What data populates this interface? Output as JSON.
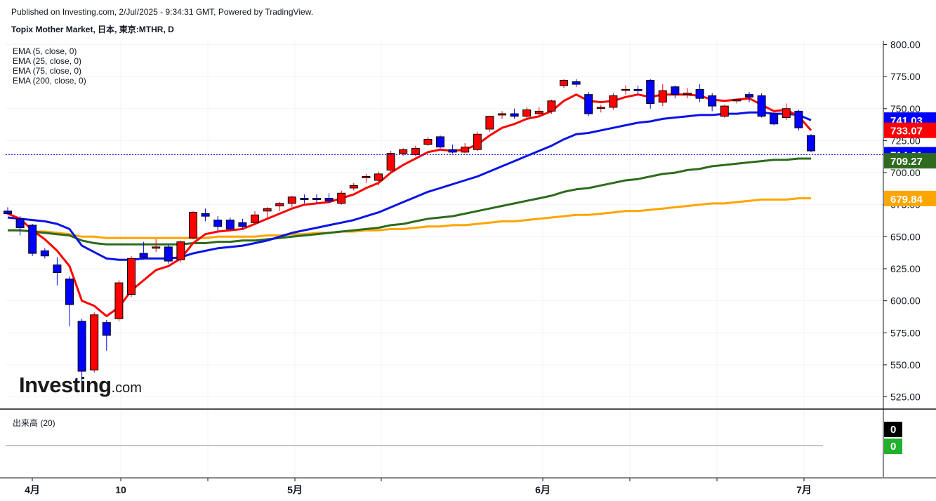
{
  "header": {
    "published": "Published on Investing.com, 2/Jul/2025 - 9:34:31 GMT, Powered by TradingView.",
    "title": "Topix Mother Market, 日本, 東京:MTHR, D"
  },
  "legend": [
    "EMA (5, close, 0)",
    "EMA (25, close, 0)",
    "EMA (75, close, 0)",
    "EMA (200, close, 0)"
  ],
  "volume_legend": "出来高 (20)",
  "logo": {
    "main": "Investing",
    "suffix": ".com"
  },
  "colors": {
    "up": "#ff0000",
    "down": "#0000ff",
    "ema5": "#ff0000",
    "ema25": "#0a14e6",
    "ema75": "#2e6b1f",
    "ema200": "#ffa500",
    "last_price_line": "#0000ff"
  },
  "chart_data": {
    "type": "candlestick",
    "x_labels": [
      "4月",
      "10",
      "5月",
      "6月",
      "7月"
    ],
    "y_ticks": [
      525,
      550,
      575,
      600,
      625,
      650,
      675,
      700,
      725,
      750,
      775,
      800
    ],
    "y_tick_labels": [
      "525.00",
      "550.00",
      "575.00",
      "600.00",
      "625.00",
      "650.00",
      "675.00",
      "700.00",
      "725.00",
      "750.00",
      "775.00",
      "800.00"
    ],
    "ylim": [
      516,
      803
    ],
    "grid": true,
    "last_price": 714.01,
    "price_labels": [
      {
        "value": 741.03,
        "text": "741.03",
        "color": "#0000ff"
      },
      {
        "value": 733.07,
        "text": "733.07",
        "color": "#ff0000"
      },
      {
        "value": 714.01,
        "text": "714.01",
        "color": "#0000ff"
      },
      {
        "value": 709.27,
        "text": "709.27",
        "color": "#2e6b1f"
      },
      {
        "value": 679.84,
        "text": "679.84",
        "color": "#ffa500"
      }
    ],
    "candles": [
      {
        "o": 670,
        "h": 673,
        "l": 667,
        "c": 668
      },
      {
        "o": 664,
        "h": 666,
        "l": 651,
        "c": 657
      },
      {
        "o": 659,
        "h": 660,
        "l": 635,
        "c": 637
      },
      {
        "o": 639,
        "h": 641,
        "l": 633,
        "c": 635
      },
      {
        "o": 628,
        "h": 634,
        "l": 612,
        "c": 622
      },
      {
        "o": 617,
        "h": 619,
        "l": 580,
        "c": 597
      },
      {
        "o": 584,
        "h": 586,
        "l": 533,
        "c": 545
      },
      {
        "o": 546,
        "h": 591,
        "l": 544,
        "c": 589
      },
      {
        "o": 583,
        "h": 585,
        "l": 561,
        "c": 573
      },
      {
        "o": 586,
        "h": 616,
        "l": 584,
        "c": 614
      },
      {
        "o": 605,
        "h": 635,
        "l": 603,
        "c": 633
      },
      {
        "o": 637,
        "h": 646,
        "l": 632,
        "c": 634
      },
      {
        "o": 641,
        "h": 648,
        "l": 638,
        "c": 642
      },
      {
        "o": 642,
        "h": 644,
        "l": 629,
        "c": 631
      },
      {
        "o": 632,
        "h": 647,
        "l": 630,
        "c": 646
      },
      {
        "o": 649,
        "h": 670,
        "l": 648,
        "c": 669
      },
      {
        "o": 668,
        "h": 672,
        "l": 662,
        "c": 666
      },
      {
        "o": 663,
        "h": 666,
        "l": 654,
        "c": 658
      },
      {
        "o": 663,
        "h": 665,
        "l": 657,
        "c": 656
      },
      {
        "o": 661,
        "h": 664,
        "l": 656,
        "c": 658
      },
      {
        "o": 661,
        "h": 670,
        "l": 659,
        "c": 667
      },
      {
        "o": 670,
        "h": 673,
        "l": 665,
        "c": 672
      },
      {
        "o": 674,
        "h": 677,
        "l": 670,
        "c": 676
      },
      {
        "o": 676,
        "h": 682,
        "l": 673,
        "c": 681
      },
      {
        "o": 680,
        "h": 683,
        "l": 676,
        "c": 679
      },
      {
        "o": 680,
        "h": 683,
        "l": 676,
        "c": 679
      },
      {
        "o": 680,
        "h": 684,
        "l": 676,
        "c": 678
      },
      {
        "o": 676,
        "h": 686,
        "l": 675,
        "c": 684
      },
      {
        "o": 688,
        "h": 692,
        "l": 686,
        "c": 690
      },
      {
        "o": 696,
        "h": 699,
        "l": 692,
        "c": 697
      },
      {
        "o": 694,
        "h": 701,
        "l": 690,
        "c": 699
      },
      {
        "o": 702,
        "h": 717,
        "l": 700,
        "c": 715
      },
      {
        "o": 715,
        "h": 719,
        "l": 713,
        "c": 718
      },
      {
        "o": 714,
        "h": 721,
        "l": 713,
        "c": 719
      },
      {
        "o": 722,
        "h": 728,
        "l": 721,
        "c": 726
      },
      {
        "o": 728,
        "h": 729,
        "l": 719,
        "c": 720
      },
      {
        "o": 718,
        "h": 722,
        "l": 715,
        "c": 716
      },
      {
        "o": 716,
        "h": 723,
        "l": 715,
        "c": 720
      },
      {
        "o": 718,
        "h": 732,
        "l": 717,
        "c": 730
      },
      {
        "o": 734,
        "h": 744,
        "l": 732,
        "c": 744
      },
      {
        "o": 745,
        "h": 748,
        "l": 742,
        "c": 746
      },
      {
        "o": 746,
        "h": 750,
        "l": 742,
        "c": 744
      },
      {
        "o": 744,
        "h": 751,
        "l": 742,
        "c": 749
      },
      {
        "o": 746,
        "h": 751,
        "l": 743,
        "c": 748
      },
      {
        "o": 748,
        "h": 757,
        "l": 746,
        "c": 756
      },
      {
        "o": 768,
        "h": 773,
        "l": 766,
        "c": 772
      },
      {
        "o": 771,
        "h": 773,
        "l": 767,
        "c": 769
      },
      {
        "o": 761,
        "h": 763,
        "l": 744,
        "c": 746
      },
      {
        "o": 751,
        "h": 753,
        "l": 747,
        "c": 751
      },
      {
        "o": 751,
        "h": 762,
        "l": 749,
        "c": 760
      },
      {
        "o": 765,
        "h": 768,
        "l": 761,
        "c": 765
      },
      {
        "o": 765,
        "h": 768,
        "l": 761,
        "c": 764
      },
      {
        "o": 772,
        "h": 773,
        "l": 750,
        "c": 754
      },
      {
        "o": 755,
        "h": 769,
        "l": 752,
        "c": 764
      },
      {
        "o": 767,
        "h": 768,
        "l": 758,
        "c": 761
      },
      {
        "o": 761,
        "h": 766,
        "l": 758,
        "c": 762
      },
      {
        "o": 765,
        "h": 769,
        "l": 755,
        "c": 758
      },
      {
        "o": 760,
        "h": 762,
        "l": 748,
        "c": 752
      },
      {
        "o": 744,
        "h": 753,
        "l": 743,
        "c": 752
      },
      {
        "o": 756,
        "h": 758,
        "l": 754,
        "c": 757
      },
      {
        "o": 761,
        "h": 763,
        "l": 755,
        "c": 759
      },
      {
        "o": 760,
        "h": 762,
        "l": 743,
        "c": 744
      },
      {
        "o": 746,
        "h": 747,
        "l": 737,
        "c": 738
      },
      {
        "o": 743,
        "h": 754,
        "l": 741,
        "c": 750
      },
      {
        "o": 748,
        "h": 749,
        "l": 733,
        "c": 735
      },
      {
        "o": 729,
        "h": 730,
        "l": 716,
        "c": 717
      }
    ],
    "ema": [
      {
        "name": "EMA (5, close, 0)",
        "color": "#ff0000",
        "values": [
          668,
          664,
          655,
          648,
          639,
          627,
          600,
          596,
          588,
          595,
          608,
          616,
          624,
          627,
          633,
          645,
          652,
          654,
          655,
          656,
          660,
          664,
          668,
          672,
          675,
          676,
          677,
          680,
          683,
          688,
          692,
          700,
          706,
          711,
          716,
          718,
          717,
          718,
          722,
          729,
          735,
          738,
          742,
          744,
          748,
          756,
          761,
          756,
          755,
          756,
          759,
          761,
          759,
          761,
          761,
          761,
          760,
          757,
          756,
          757,
          758,
          753,
          748,
          749,
          744,
          733
        ]
      },
      {
        "name": "EMA (25, close, 0)",
        "color": "#0a14e6",
        "values": [
          665,
          664,
          663,
          662,
          660,
          656,
          643,
          638,
          633,
          632,
          632,
          633,
          633,
          633,
          634,
          637,
          639,
          641,
          642,
          643,
          645,
          647,
          650,
          653,
          655,
          657,
          659,
          661,
          663,
          666,
          669,
          673,
          677,
          681,
          685,
          688,
          691,
          694,
          697,
          701,
          705,
          709,
          713,
          717,
          721,
          726,
          730,
          731,
          733,
          735,
          737,
          739,
          740,
          742,
          743,
          744,
          745,
          745,
          746,
          746,
          747,
          747,
          746,
          746,
          745,
          741
        ]
      },
      {
        "name": "EMA (75, close, 0)",
        "color": "#2e6b1f",
        "values": [
          655,
          655,
          654,
          653,
          652,
          651,
          647,
          645,
          644,
          644,
          644,
          644,
          644,
          644,
          644,
          645,
          645,
          646,
          646,
          647,
          647,
          648,
          649,
          650,
          651,
          652,
          653,
          654,
          655,
          656,
          657,
          659,
          660,
          662,
          664,
          665,
          666,
          668,
          670,
          672,
          674,
          676,
          678,
          680,
          682,
          685,
          687,
          688,
          690,
          692,
          694,
          695,
          697,
          699,
          700,
          702,
          703,
          705,
          706,
          707,
          708,
          709,
          710,
          710,
          711,
          711
        ]
      },
      {
        "name": "EMA (200, close, 0)",
        "color": "#ffa500",
        "values": [
          655,
          655,
          654,
          654,
          653,
          652,
          650,
          650,
          649,
          649,
          649,
          649,
          649,
          649,
          649,
          649,
          649,
          650,
          650,
          650,
          650,
          651,
          651,
          652,
          652,
          653,
          653,
          654,
          654,
          655,
          655,
          656,
          656,
          657,
          658,
          658,
          659,
          659,
          660,
          661,
          662,
          662,
          663,
          664,
          665,
          666,
          667,
          667,
          668,
          669,
          670,
          670,
          671,
          672,
          673,
          674,
          675,
          676,
          676,
          677,
          678,
          679,
          679,
          679,
          680,
          680
        ]
      }
    ]
  }
}
